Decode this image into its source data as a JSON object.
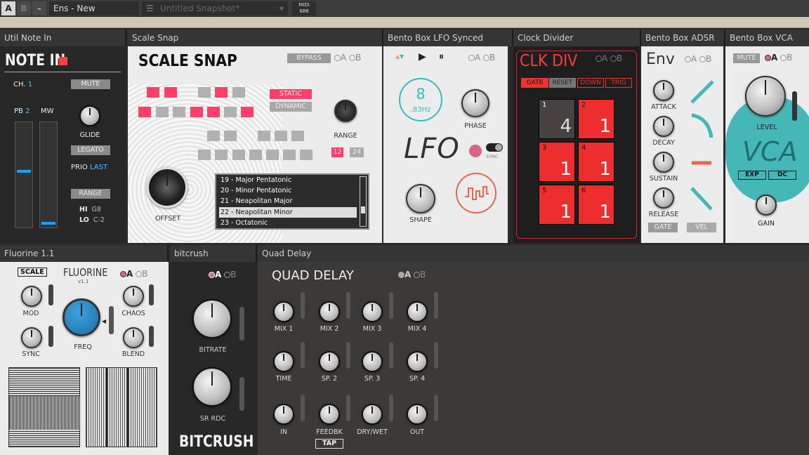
{
  "topbar": {
    "a": "A",
    "b": "B",
    "menu": "–",
    "preset": "Ens - New",
    "snapshot_placeholder": "Untitled Snapshot*",
    "midi": "MIDI",
    "midi_val": "686"
  },
  "headers": {
    "util_note_in": "Util Note In",
    "scale_snap": "Scale Snap",
    "lfo": "Bento Box LFO Synced",
    "clock_divider": "Clock Divider",
    "adsr": "Bento Box ADSR",
    "vca": "Bento Box VCA",
    "fluorine": "Fluorine 1.1",
    "bitcrush": "bitcrush",
    "quad_delay": "Quad Delay"
  },
  "ab": {
    "a": "A",
    "b": "B"
  },
  "note_in": {
    "title": "NOTE IN",
    "ch_label": "CH.",
    "ch_val": "1",
    "mute": "MUTE",
    "pb_label": "PB",
    "pb_val": "2",
    "mw_label": "MW",
    "glide": "GLIDE",
    "legato": "LEGATO",
    "prio_label": "PRIO",
    "prio_val": "LAST",
    "range": "RANGE",
    "hi_label": "HI",
    "hi_val": "G8",
    "lo_label": "LO",
    "lo_val": "C-2"
  },
  "scale_snap": {
    "title": "SCALE SNAP",
    "bypass": "BYPASS",
    "static": "STATIC",
    "dynamic": "DYNAMIC",
    "range": "RANGE",
    "r12": "12",
    "r24": "24",
    "offset": "OFFSET",
    "scales": [
      "19 - Major Pentatonic",
      "20 - Minor Pentatonic",
      "21 - Neapolitan Major",
      "22 - Neapolitan Minor",
      "23 - Octatonic"
    ],
    "selected": 3
  },
  "lfo": {
    "rate": "8",
    "hz": ".83Hz",
    "phase": "PHASE",
    "title": "LFO",
    "sync": "SYNC",
    "shape": "SHAPE"
  },
  "clk": {
    "title": "CLK DIV",
    "gate": "GATE",
    "reset": "RESET",
    "down": "DOWN",
    "trig": "TRIG",
    "cells": [
      {
        "n": "1",
        "v": "4"
      },
      {
        "n": "2",
        "v": "1"
      },
      {
        "n": "3",
        "v": "1"
      },
      {
        "n": "4",
        "v": "1"
      },
      {
        "n": "5",
        "v": "1"
      },
      {
        "n": "6",
        "v": "1"
      }
    ]
  },
  "adsr": {
    "title": "Env",
    "attack": "ATTACK",
    "decay": "DECAY",
    "sustain": "SUSTAIN",
    "release": "RELEASE",
    "gate": "GATE",
    "vel": "VEL"
  },
  "vca": {
    "mute": "MUTE",
    "level": "LEVEL",
    "title": "VCA",
    "exp": "EXP",
    "dc": "DC",
    "gain": "GAIN"
  },
  "fluorine": {
    "scale": "SCALE",
    "title": "FLUORINE",
    "version": "v1.1",
    "mod": "MOD",
    "chaos": "CHAOS",
    "freq": "FREQ",
    "sync": "SYNC",
    "blend": "BLEND"
  },
  "bitcrush": {
    "bitrate": "BITRATE",
    "srrdc": "SR RDC",
    "title": "BITCRUSH"
  },
  "quad": {
    "title": "QUAD DELAY",
    "row1": [
      "MIX 1",
      "MIX 2",
      "MIX 3",
      "MIX 4"
    ],
    "row2": [
      "TIME",
      "SP. 2",
      "SP. 3",
      "SP. 4"
    ],
    "row3": [
      "IN",
      "FEEDBK",
      "DRY/WET",
      "OUT"
    ],
    "tap": "TAP"
  }
}
